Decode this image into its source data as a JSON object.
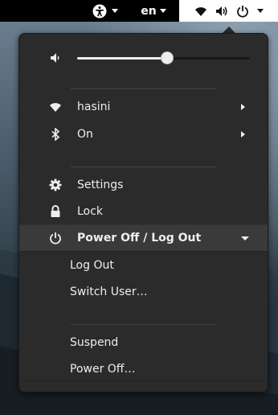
{
  "topbar": {
    "accessibility_icon": "accessibility-icon",
    "language": "en",
    "status_icons": [
      "wifi-icon",
      "volume-icon",
      "power-icon"
    ]
  },
  "menu": {
    "volume": {
      "icon": "volume-low-icon",
      "level": 0.52
    },
    "network": {
      "icon": "wifi-icon",
      "label": "hasini"
    },
    "bluetooth": {
      "icon": "bluetooth-icon",
      "label": "On"
    },
    "settings": {
      "icon": "gear-icon",
      "label": "Settings"
    },
    "lock": {
      "icon": "lock-icon",
      "label": "Lock"
    },
    "power": {
      "icon": "power-icon",
      "label": "Power Off / Log Out",
      "items": [
        "Log Out",
        "Switch User…",
        "Suspend",
        "Power Off…"
      ]
    }
  }
}
